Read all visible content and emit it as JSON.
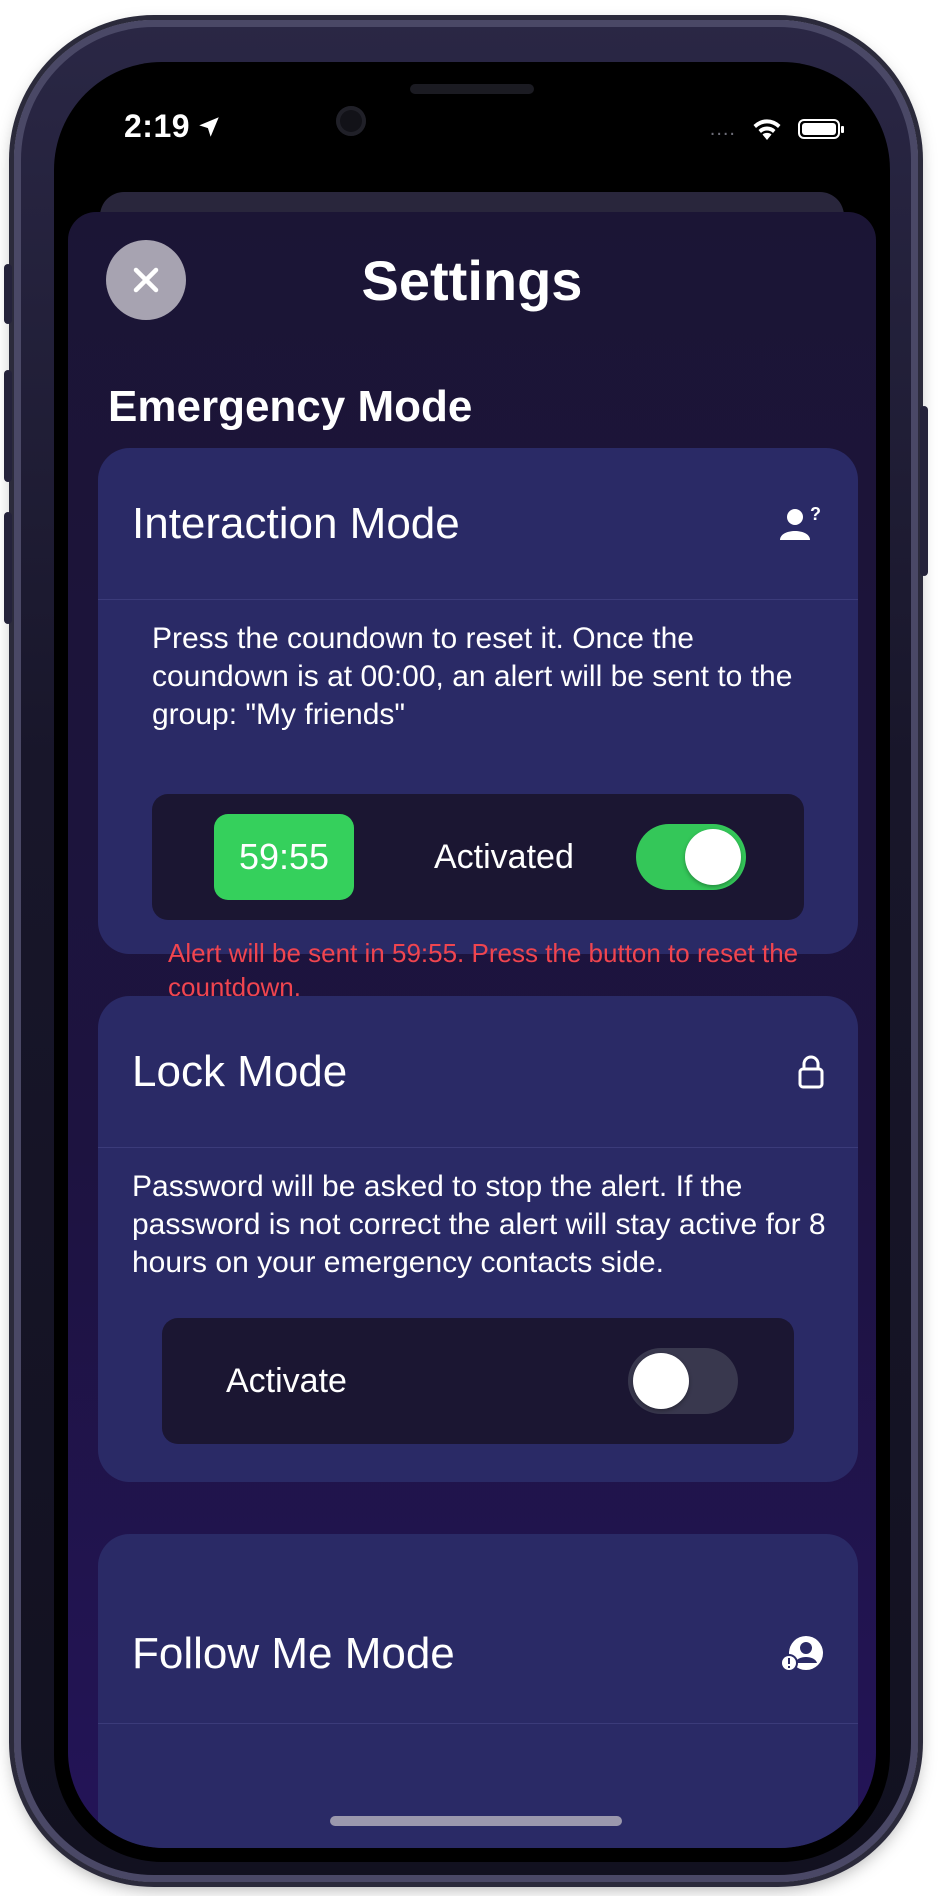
{
  "status_bar": {
    "time": "2:19",
    "location_icon": "location-arrow-icon",
    "signal_dots": "....",
    "wifi_icon": "wifi-icon",
    "battery_icon": "battery-icon"
  },
  "header": {
    "title": "Settings",
    "close_icon": "close-icon"
  },
  "section": {
    "title": "Emergency Mode"
  },
  "interaction_card": {
    "title": "Interaction Mode",
    "icon": "person-question-icon",
    "description": "Press the coundown to reset it. Once the coundown is at 00:00, an alert will be sent to the group: \"My friends\"",
    "timer": "59:55",
    "toggle_label": "Activated",
    "toggle_on": true,
    "warning": "Alert will be sent in 59:55. Press the button to reset the countdown."
  },
  "lock_card": {
    "title": "Lock Mode",
    "icon": "lock-icon",
    "description": "Password will be asked to stop the alert. If the password is not correct the alert will stay active for 8 hours on your emergency contacts side.",
    "toggle_label": "Activate",
    "toggle_on": false
  },
  "follow_card": {
    "title": "Follow Me Mode",
    "icon": "person-alert-icon"
  },
  "colors": {
    "accent_green": "#35d05c",
    "warning_red": "#f0454f",
    "card": "#2a2a66"
  }
}
